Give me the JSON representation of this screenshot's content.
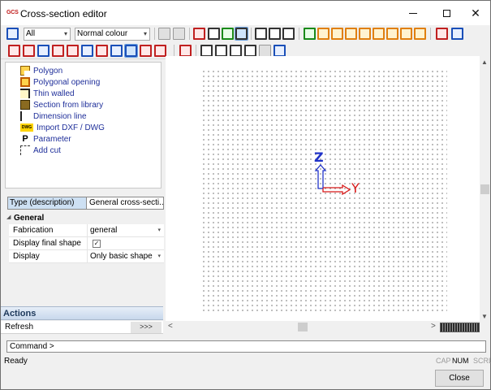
{
  "window": {
    "app_logo": "GCS",
    "title": "Cross-section editor",
    "minimize_icon": "minimize-icon",
    "maximize_icon": "maximize-icon",
    "close_glyph": "✕"
  },
  "toolbar": {
    "filter_combo": "All",
    "colour_combo": "Normal colour",
    "combo_arrow": "▾"
  },
  "insert_list": {
    "items": [
      {
        "label": "Polygon",
        "icon": "polygon-icon"
      },
      {
        "label": "Polygonal opening",
        "icon": "polygonal-opening-icon"
      },
      {
        "label": "Thin walled",
        "icon": "thin-walled-icon"
      },
      {
        "label": "Section from library",
        "icon": "section-library-icon"
      },
      {
        "label": "Dimension line",
        "icon": "dimension-line-icon"
      },
      {
        "label": "Import DXF / DWG",
        "icon": "dwg-icon",
        "icon_text": "DWG"
      },
      {
        "label": "Parameter",
        "icon": "parameter-icon",
        "icon_text": "P"
      },
      {
        "label": "Add cut",
        "icon": "add-cut-icon"
      }
    ]
  },
  "properties": {
    "header_key": "Type (description)",
    "header_value": "General cross-secti...",
    "category": "General",
    "category_arrow": "◢",
    "rows": [
      {
        "key": "Fabrication",
        "value": "general"
      },
      {
        "key": "Display final shape",
        "value": "✓"
      },
      {
        "key": "Display",
        "value": "Only basic shape"
      }
    ]
  },
  "actions": {
    "header": "Actions",
    "item": "Refresh",
    "more": ">>>"
  },
  "canvas": {
    "axis_z": "Z",
    "axis_y": "Y"
  },
  "scroll": {
    "up": "▲",
    "down": "▼",
    "left": "<",
    "right": ">"
  },
  "command": {
    "prompt": "Command >"
  },
  "status": {
    "ready": "Ready",
    "cap": "CAP",
    "num": "NUM",
    "scrl": "SCRL"
  },
  "buttons": {
    "close": "Close"
  },
  "colors": {
    "axis_z": "#2033c8",
    "axis_y": "#d81818",
    "selection": "#cde0f3"
  }
}
